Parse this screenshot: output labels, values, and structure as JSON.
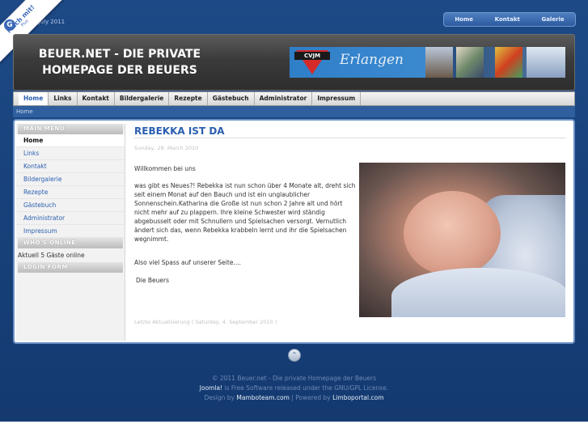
{
  "topbar": {
    "date": "y, 9. July 2011",
    "nav": [
      "Home",
      "Kontakt",
      "Galerie"
    ]
  },
  "badge": {
    "line1": "Mach mit!",
    "line2": "Plus",
    "icon": "G"
  },
  "header": {
    "title_line1": "BEUER.NET - DIE PRIVATE",
    "title_line2": "HOMEPAGE DER BEUERS",
    "banner_box": "CVJM",
    "banner_text": "Erlangen"
  },
  "mainnav": [
    "Home",
    "Links",
    "Kontakt",
    "Bildergalerie",
    "Rezepte",
    "Gästebuch",
    "Administrator",
    "Impressum"
  ],
  "breadcrumb": "Home",
  "sidebar": {
    "main_menu_title": "MAIN MENU",
    "menu": [
      "Home",
      "Links",
      "Kontakt",
      "Bildergalerie",
      "Rezepte",
      "Gästebuch",
      "Administrator",
      "Impressum"
    ],
    "whos_online_title": "WHO'S ONLINE",
    "online_text": "Aktuell 5 Gäste online",
    "login_title": "LOGIN FORM"
  },
  "article": {
    "title": "REBEKKA IST DA",
    "date": "Sunday, 28. March 2010",
    "intro": "Willkommen bei uns",
    "body": "was gibt es Neues?! Rebekka ist nun schon über 4 Monate alt, dreht sich seit einem Monat auf den Bauch und ist ein unglaublicher Sonnenschein.Katharina die Große ist nun schon 2 Jahre alt und hört nicht mehr auf zu plappern. Ihre kleine Schwester wird ständig abgebusselt oder mit Schnullern und Spielsachen versorgt. Vernutlich ändert sich das, wenn Rebekka krabbeln lernt und ihr die Spielsachen wegnimmt.",
    "fun": "Also viel Spass auf unserer Seite....",
    "signature": "Die Beuers",
    "modified": "Letzte Aktualisierung ( Saturday, 4. September 2010 )"
  },
  "footer": {
    "line1": "© 2011 Beuer.net - Die private Homepage der Beuers",
    "line2_a": "Joomla!",
    "line2_b": " is Free Software released under the GNU/GPL License.",
    "line3_a": "Design by ",
    "line3_b": "Mamboteam.com",
    "line3_c": " | Powered by ",
    "line3_d": "Limboportal.com"
  },
  "colors": {
    "background": "#173f78",
    "accent": "#2b5fb0",
    "header": "#3b3b3b"
  }
}
